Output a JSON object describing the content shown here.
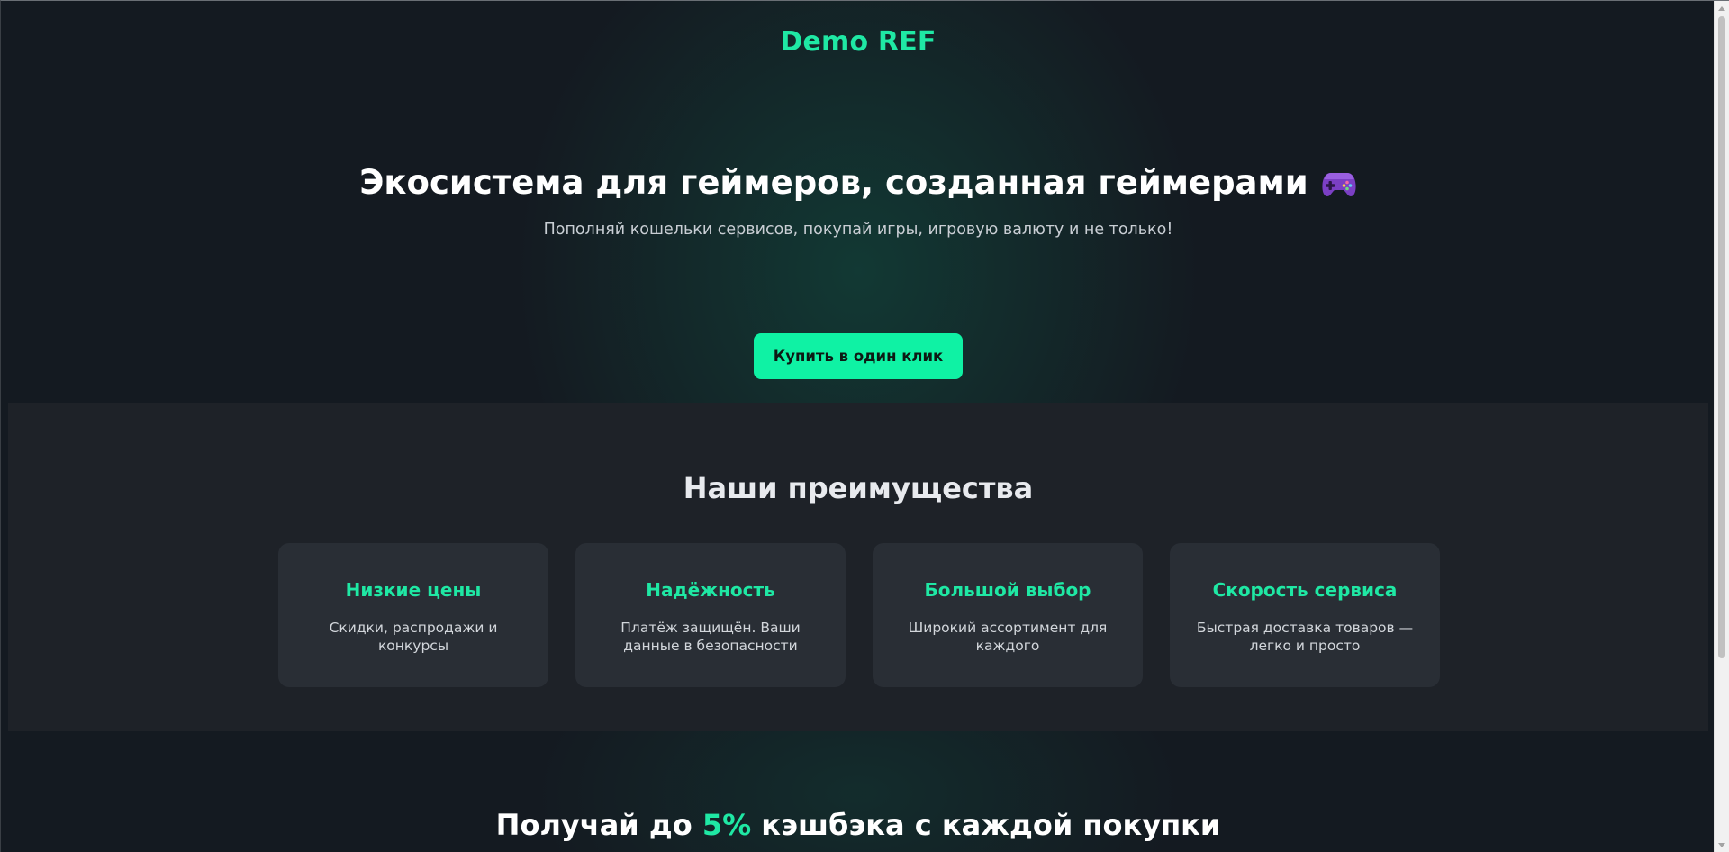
{
  "header": {
    "brand": "Demo REF"
  },
  "hero": {
    "title": "Экосистема для геймеров, созданная геймерами",
    "title_icon": "gamepad-icon",
    "subtitle": "Пополняй кошельки сервисов, покупай игры, игровую валюту и не только!",
    "cta_label": "Купить в один клик"
  },
  "advantages": {
    "title": "Наши преимущества",
    "items": [
      {
        "title": "Низкие цены",
        "text": "Скидки, распродажи и конкурсы"
      },
      {
        "title": "Надёжность",
        "text": "Платёж защищён. Ваши данные в безопасности"
      },
      {
        "title": "Большой выбор",
        "text": "Широкий ассортимент для каждого"
      },
      {
        "title": "Скорость сервиса",
        "text": "Быстрая доставка товаров — легко и просто"
      }
    ]
  },
  "cashback": {
    "prefix": "Получай до",
    "accent": "5%",
    "suffix": "кэшбэка с каждой покупки"
  },
  "colors": {
    "accent": "#1fe8a4",
    "button": "#0ff2a4",
    "background": "#141a21",
    "section_bg": "#1e2228",
    "card_bg": "#292e35",
    "gamepad": "#7b3fc4"
  }
}
